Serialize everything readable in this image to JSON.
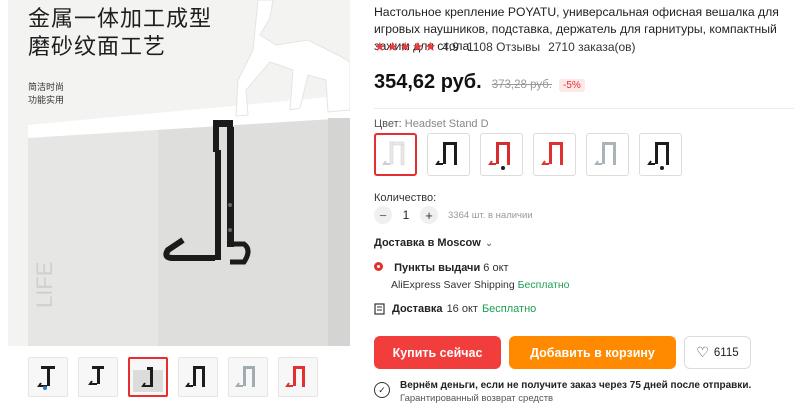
{
  "gallery": {
    "promo_title": "金属一体加工成型\n磨砂纹面工艺",
    "promo_sub": "简洁时尚\n功能实用",
    "thumbnails": [
      "thumb-1",
      "thumb-2",
      "thumb-3",
      "thumb-4",
      "thumb-5",
      "thumb-6"
    ],
    "active_thumb": 2
  },
  "product": {
    "title": "Настольное крепление POYATU, универсальная офисная вешалка для игровых наушников, подставка, держатель для гарнитуры, компактный зажим для стола",
    "rating": "4.9",
    "stars": 5,
    "reviews": "1108 Отзывы",
    "orders": "2710 заказа(ов)",
    "price": "354,62 руб.",
    "old_price": "373,28 руб.",
    "discount": "-5%"
  },
  "color": {
    "label": "Цвет:",
    "value": "Headset Stand D",
    "swatches": [
      {
        "name": "white",
        "color": "#f2f2f2"
      },
      {
        "name": "black",
        "color": "#1c1c1c"
      },
      {
        "name": "red",
        "color": "#d82c2c"
      },
      {
        "name": "red",
        "color": "#e03030"
      },
      {
        "name": "grey",
        "color": "#a9b4b9"
      },
      {
        "name": "black",
        "color": "#1c1c1c"
      }
    ],
    "active": 0
  },
  "quantity": {
    "label": "Количество:",
    "minus": "−",
    "value": "1",
    "plus": "+",
    "stock": "3364 шт. в наличии"
  },
  "shipping": {
    "header": "Доставка в Moscow",
    "pickup_label": "Пункты выдачи",
    "pickup_date": "6 окт",
    "pickup_method": "AliExpress Saver Shipping",
    "pickup_price": "Бесплатно",
    "delivery_label": "Доставка",
    "delivery_date": "16 окт",
    "delivery_price": "Бесплатно"
  },
  "actions": {
    "buy": "Купить сейчас",
    "cart": "Добавить в корзину",
    "wishlist_count": "6115"
  },
  "guarantee": {
    "line1": "Вернём деньги, если не получите заказ через 75 дней после отправки.",
    "line2": "Гарантированный возврат средств"
  },
  "colors": {
    "accent": "#f23d3d",
    "cart": "#ff8a00",
    "free": "#1aa053"
  }
}
